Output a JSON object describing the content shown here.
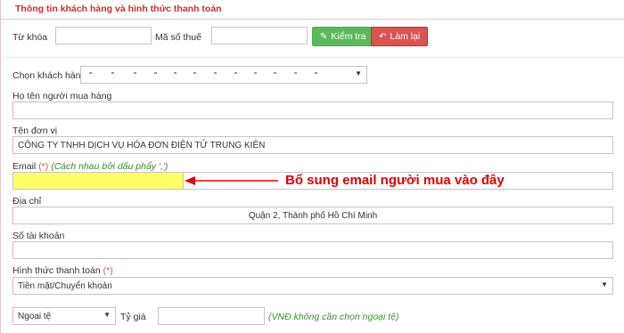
{
  "panel": {
    "title": "Thông tin khách hàng và hình thức thanh toán"
  },
  "search": {
    "keyword_label": "Từ khóa",
    "keyword_value": "",
    "tax_code_label": "Mã số thuế",
    "tax_code_value": "",
    "check_button": "Kiểm tra",
    "reset_button": "Làm lại"
  },
  "customer": {
    "select_label": "Chọn khách hàng",
    "buyer_name_label": "Họ tên người mua hàng",
    "buyer_name_value": "",
    "unit_name_label": "Tên đơn vị",
    "unit_name_value": "CÔNG TY TNHH DỊCH VỤ HÓA ĐƠN ĐIỆN TỬ TRUNG KIÊN",
    "email_label": "Email",
    "email_required": "(*)",
    "email_hint": "(Cách nhau bởi dấu phẩy ',')",
    "email_value": "",
    "address_label": "Địa chỉ",
    "address_value": "Quận 2, Thành phố Hồ Chí Minh",
    "account_label": "Số tài khoản",
    "account_value": ""
  },
  "payment": {
    "method_label": "Hình thức thanh toán",
    "method_required": "(*)",
    "method_value": "Tiền mặt/Chuyển khoản",
    "currency_value": "Ngoại tệ",
    "rate_label": "Tỷ giá",
    "rate_value": "",
    "rate_hint": "(VNĐ không cần chọn ngoại tệ)"
  },
  "annotation": {
    "text": "Bổ sung email người mua vào đây"
  },
  "colors": {
    "title_red": "#c9302c",
    "button_green": "#5cb85c",
    "button_red": "#d9534f",
    "highlight_yellow": "#ffff66",
    "annotation_red": "#e00000",
    "hint_green": "#3c8d2f"
  },
  "icons": {
    "check_button": "edit-icon",
    "reset_button": "undo-icon",
    "select_caret": "caret-down-icon",
    "annotation": "arrow-left-icon"
  }
}
